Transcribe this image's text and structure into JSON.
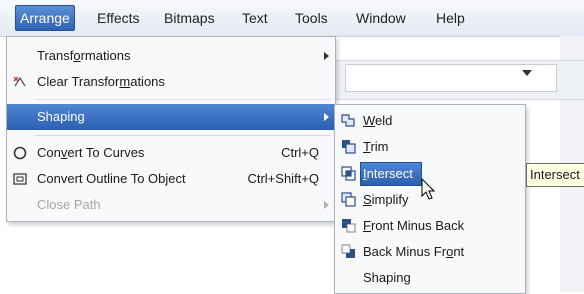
{
  "menubar": {
    "items": [
      {
        "label": "Arrange",
        "active": true
      },
      {
        "label": "Effects"
      },
      {
        "label": "Bitmaps"
      },
      {
        "label": "Text"
      },
      {
        "label": "Tools"
      },
      {
        "label": "Window"
      },
      {
        "label": "Help"
      }
    ]
  },
  "arrange_menu": {
    "transformations": {
      "pre": "Transf",
      "u": "o",
      "post": "rmations"
    },
    "clear_transformations": {
      "pre": "Clear Transfor",
      "u": "m",
      "post": "ations"
    },
    "shaping": {
      "label": "Shaping"
    },
    "convert_to_curves": {
      "pre": "Con",
      "u": "v",
      "post": "ert To Curves",
      "shortcut": "Ctrl+Q"
    },
    "convert_outline": {
      "pre": "Convert Outline To Ob",
      "u": "j",
      "post": "ect",
      "shortcut": "Ctrl+Shift+Q"
    },
    "close_path": {
      "label": "Close Path"
    }
  },
  "shaping_menu": {
    "weld": {
      "u": "W",
      "post": "eld",
      "icon": "weld-icon"
    },
    "trim": {
      "u": "T",
      "post": "rim",
      "icon": "trim-icon"
    },
    "intersect": {
      "pre": "",
      "u": "I",
      "post": "ntersect",
      "icon": "intersect-icon"
    },
    "simplify": {
      "u": "S",
      "post": "implify",
      "icon": "simplify-icon"
    },
    "front_minus_back": {
      "u": "F",
      "post": "ront Minus Back",
      "icon": "front-minus-back-icon"
    },
    "back_minus_front": {
      "pre": "Back Minus Fr",
      "u": "o",
      "post": "nt",
      "icon": "back-minus-front-icon"
    },
    "shaping_docker": {
      "label": "Shaping",
      "icon": ""
    }
  },
  "tooltip": {
    "text": "Intersect"
  },
  "colors": {
    "highlight": "#2f63b5",
    "menu_bg": "#f8f9fb",
    "tooltip_bg": "#ffffe1"
  }
}
